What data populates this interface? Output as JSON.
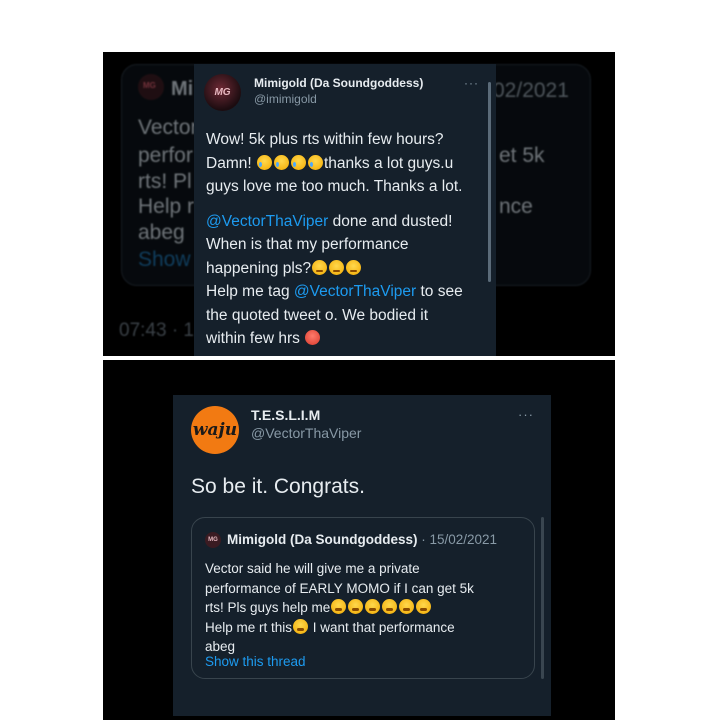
{
  "background_tweet": {
    "name": "Mi",
    "date": "02/2021",
    "lines_left": [
      "Vector",
      "perfor",
      "rts! Pl",
      "Help r",
      "abeg"
    ],
    "lines_right": [
      "et 5k",
      "nce"
    ],
    "show_label": "Show",
    "time": "07:43 · 1"
  },
  "overlay_tweet": {
    "avatar_text": "MG",
    "name": "Mimigold (Da Soundgoddess)",
    "handle": "@imimigold",
    "more": "···",
    "p1_line1": "Wow! 5k plus rts within few hours?",
    "p1_line2a": "Damn!",
    "p1_line2b": "thanks a lot guys.u",
    "p1_line3": "guys love me too much. Thanks a lot.",
    "mention": "@VectorThaViper",
    "p2_line1_rest": " done and dusted!",
    "p2_line2": "When is that my performance",
    "p2_line3": "happening pls?",
    "p3_line1_pre": "Help me tag ",
    "p3_line1_post": " to see",
    "p3_line2": "the quoted tweet o. We bodied it",
    "p3_line3": "within few hrs"
  },
  "main_tweet": {
    "avatar_text": "waju",
    "name": "T.E.S.L.I.M",
    "handle": "@VectorThaViper",
    "more": "···",
    "text": "So be it. Congrats.",
    "quote": {
      "avatar_text": "MG",
      "name": "Mimigold (Da Soundgoddess)",
      "date": " · 15/02/2021",
      "line1": "Vector said he will give me a private",
      "line2": "performance of EARLY MOMO if I can get 5k",
      "line3": "rts! Pls guys help me",
      "line4a": "Help me rt this",
      "line4b": " I want that performance",
      "line5": "abeg",
      "show_thread": "Show this thread"
    }
  },
  "colors": {
    "tweet_bg": "#15202b",
    "link_blue": "#1d9bf0",
    "text_primary": "#e7ecf0",
    "text_secondary": "#8899a6",
    "avatar_orange": "#f27a12"
  }
}
